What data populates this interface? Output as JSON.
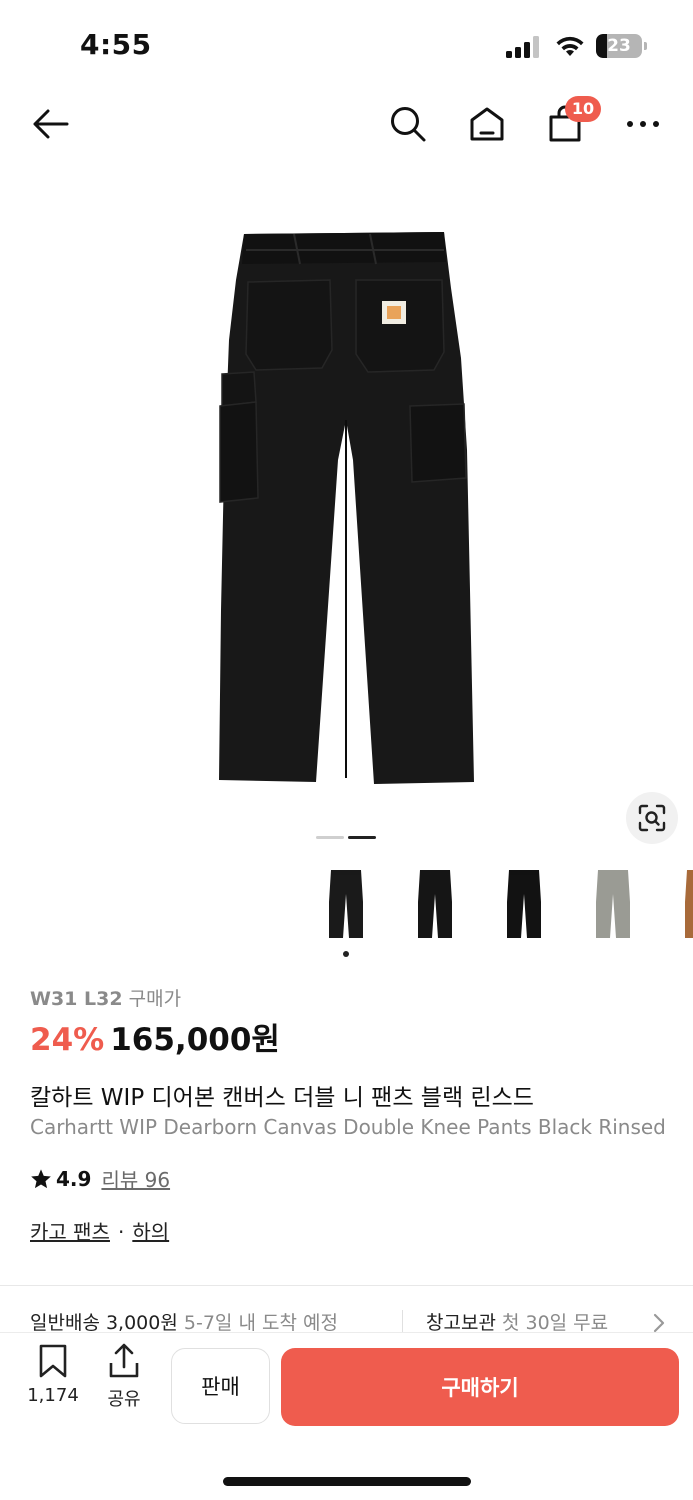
{
  "status_bar": {
    "time": "4:55",
    "battery_level": "23",
    "battery_fraction": 0.23
  },
  "nav": {
    "cart_badge": "10",
    "icons": [
      "back-arrow-icon",
      "search-icon",
      "home-icon",
      "shopping-bag-icon",
      "more-icon"
    ]
  },
  "gallery": {
    "page_index": 2,
    "page_count": 2,
    "thumbnails": [
      {
        "name": "black-pants-back",
        "color": "#1a1a1a",
        "selected": true
      },
      {
        "name": "black-pants-front",
        "color": "#151515",
        "selected": false
      },
      {
        "name": "black-pants-alt",
        "color": "#121212",
        "selected": false
      },
      {
        "name": "grey-pants",
        "color": "#9a9b94",
        "selected": false
      },
      {
        "name": "brown-pants",
        "color": "#a86a3a",
        "selected": false
      }
    ]
  },
  "product": {
    "size": "W31 L32",
    "size_suffix": "구매가",
    "discount": "24%",
    "price": "165,000원",
    "name_ko": "칼하트 WIP 디어본 캔버스 더블 니 팬츠 블랙 린스드",
    "name_en": "Carhartt WIP Dearborn Canvas Double Knee Pants Black Rinsed",
    "rating": "4.9",
    "review_label": "리뷰 96",
    "category_1": "카고 팬츠",
    "category_sep": "·",
    "category_2": "하의"
  },
  "delivery": {
    "shipping_label": "일반배송 3,000원",
    "shipping_eta": "5-7일 내 도착 예정",
    "storage_label": "창고보관",
    "storage_note": "첫 30일 무료"
  },
  "bottom_bar": {
    "wishlist_count": "1,174",
    "share_label": "공유",
    "sell_label": "판매",
    "buy_label": "구매하기"
  },
  "colors": {
    "accent": "#ef5c4e",
    "muted_text": "#8a8a8a"
  }
}
